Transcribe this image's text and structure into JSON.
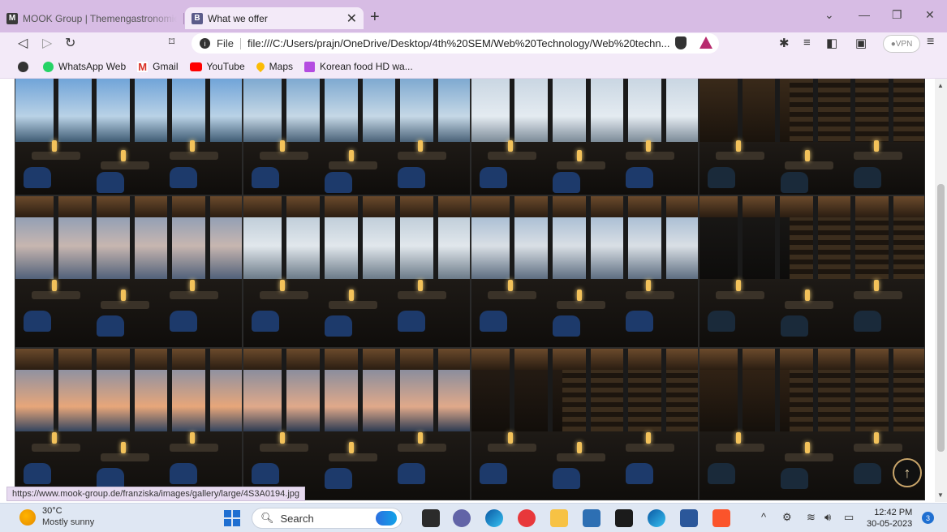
{
  "browser": {
    "tabs": [
      {
        "label": "MOOK Group | Themengastronomie a",
        "favicon": "M"
      },
      {
        "label": "What we offer",
        "favicon": "B",
        "active": true
      }
    ],
    "address": {
      "file_label": "File",
      "url": "file:///C:/Users/prajn/OneDrive/Desktop/4th%20SEM/Web%20Technology/Web%20techn..."
    },
    "vpn_label": "VPN",
    "bookmarks": [
      {
        "label": "WhatsApp Web"
      },
      {
        "label": "Gmail"
      },
      {
        "label": "YouTube"
      },
      {
        "label": "Maps"
      },
      {
        "label": "Korean food HD wa..."
      }
    ]
  },
  "page": {
    "status_link": "https://www.mook-group.de/franziska/images/gallery/large/4S3A0194.jpg",
    "back_to_top": "↑",
    "gallery": [
      {
        "alt": "restaurant-photo-1"
      },
      {
        "alt": "restaurant-photo-2"
      },
      {
        "alt": "restaurant-photo-3"
      },
      {
        "alt": "bar-photo-4"
      },
      {
        "alt": "restaurant-photo-5"
      },
      {
        "alt": "restaurant-photo-6"
      },
      {
        "alt": "restaurant-photo-7"
      },
      {
        "alt": "restaurant-photo-8"
      },
      {
        "alt": "restaurant-photo-9"
      },
      {
        "alt": "restaurant-photo-10"
      },
      {
        "alt": "restaurant-photo-11"
      },
      {
        "alt": "bar-photo-12"
      }
    ]
  },
  "taskbar": {
    "weather": {
      "temp": "30°C",
      "condition": "Mostly sunny"
    },
    "search_label": "Search",
    "time": "12:42 PM",
    "date": "30-05-2023",
    "notification_count": "3"
  }
}
